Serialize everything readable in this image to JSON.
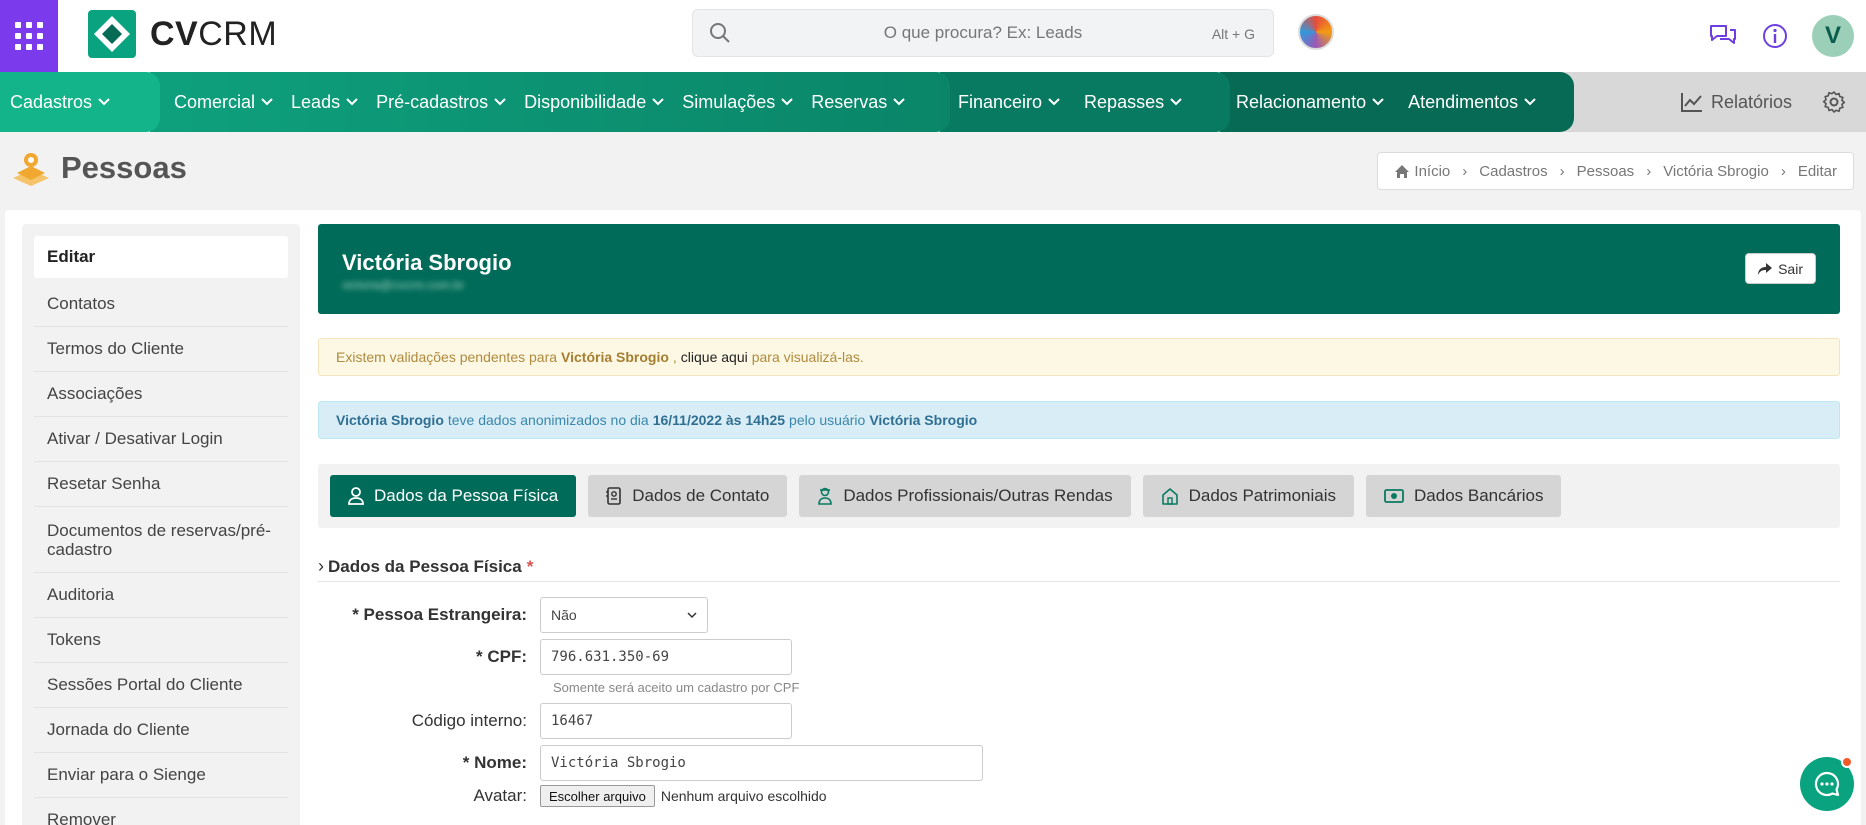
{
  "app": {
    "logo_text_bold": "CV",
    "logo_text_light": "CRM"
  },
  "search": {
    "placeholder": "O que procura? Ex: Leads",
    "shortcut": "Alt + G"
  },
  "user": {
    "initial": "V"
  },
  "nav": {
    "items": [
      {
        "label": "Cadastros"
      },
      {
        "label": "Comercial"
      },
      {
        "label": "Leads"
      },
      {
        "label": "Pré-cadastros"
      },
      {
        "label": "Disponibilidade"
      },
      {
        "label": "Simulações"
      },
      {
        "label": "Reservas"
      },
      {
        "label": "Financeiro"
      },
      {
        "label": "Repasses"
      },
      {
        "label": "Relacionamento"
      },
      {
        "label": "Atendimentos"
      }
    ],
    "reports_label": "Relatórios"
  },
  "page": {
    "title": "Pessoas",
    "breadcrumb": [
      "Início",
      "Cadastros",
      "Pessoas",
      "Victória Sbrogio",
      "Editar"
    ]
  },
  "sidebar": {
    "items": [
      {
        "label": "Editar"
      },
      {
        "label": "Contatos"
      },
      {
        "label": "Termos do Cliente"
      },
      {
        "label": "Associações"
      },
      {
        "label": "Ativar / Desativar Login"
      },
      {
        "label": "Resetar Senha"
      },
      {
        "label": "Documentos de reservas/pré-cadastro"
      },
      {
        "label": "Auditoria"
      },
      {
        "label": "Tokens"
      },
      {
        "label": "Sessões Portal do Cliente"
      },
      {
        "label": "Jornada do Cliente"
      },
      {
        "label": "Enviar para o Sienge"
      },
      {
        "label": "Remover"
      }
    ]
  },
  "hero": {
    "name": "Victória Sbrogio",
    "email": "victoria@cvcrm.com.br",
    "exit_label": "Sair"
  },
  "alerts": {
    "warning": {
      "prefix": "Existem validações pendentes para",
      "name": "Victória Sbrogio",
      "comma": ",",
      "link": "clique aqui",
      "suffix": "para visualizá-las."
    },
    "info": {
      "name": "Victória Sbrogio",
      "text1": "teve dados anonimizados no dia",
      "date": "16/11/2022 às 14h25",
      "text2": "pelo usuário",
      "user": "Victória Sbrogio"
    }
  },
  "tabs": [
    {
      "label": "Dados da Pessoa Física",
      "icon": "person-icon"
    },
    {
      "label": "Dados de Contato",
      "icon": "contact-card-icon"
    },
    {
      "label": "Dados Profissionais/Outras Rendas",
      "icon": "worker-icon"
    },
    {
      "label": "Dados Patrimoniais",
      "icon": "home-icon"
    },
    {
      "label": "Dados Bancários",
      "icon": "money-icon"
    }
  ],
  "section": {
    "title": "Dados da Pessoa Física",
    "required_mark": "*"
  },
  "form": {
    "foreigner_label": "* Pessoa Estrangeira:",
    "foreigner_value": "Não",
    "cpf_label": "* CPF:",
    "cpf_value": "796.631.350-69",
    "cpf_help": "Somente será aceito um cadastro por CPF",
    "code_label": "Código interno:",
    "code_value": "16467",
    "name_label": "* Nome:",
    "name_value": "Victória Sbrogio",
    "avatar_label": "Avatar:",
    "avatar_button": "Escolher arquivo",
    "avatar_status": "Nenhum arquivo escolhido"
  },
  "colors": {
    "brand_purple": "#7c3aed",
    "brand_green": "#006b58",
    "nav_green": "#14b48a"
  }
}
